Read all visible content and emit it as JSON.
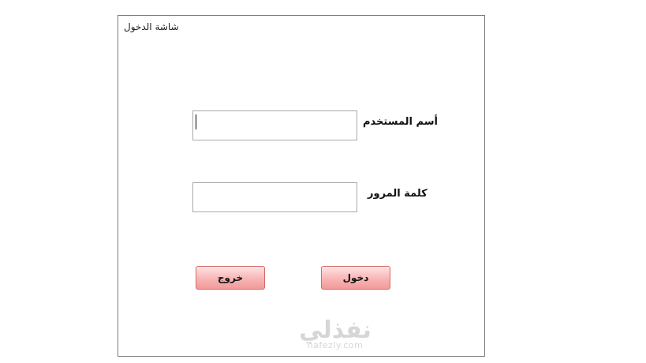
{
  "window": {
    "title": "شاشة الدخول"
  },
  "form": {
    "username_label": "أسم المستخدم",
    "username_value": "",
    "password_label": "كلمة المرور",
    "password_value": ""
  },
  "buttons": {
    "login_label": "دخول",
    "exit_label": "خروج"
  },
  "watermark": {
    "brand": "نفذلي",
    "domain": "nafezly.com"
  },
  "colors": {
    "button_fill": "#f8b4b4",
    "button_border": "#d46a6a",
    "frame_border": "#7a7a7a"
  }
}
